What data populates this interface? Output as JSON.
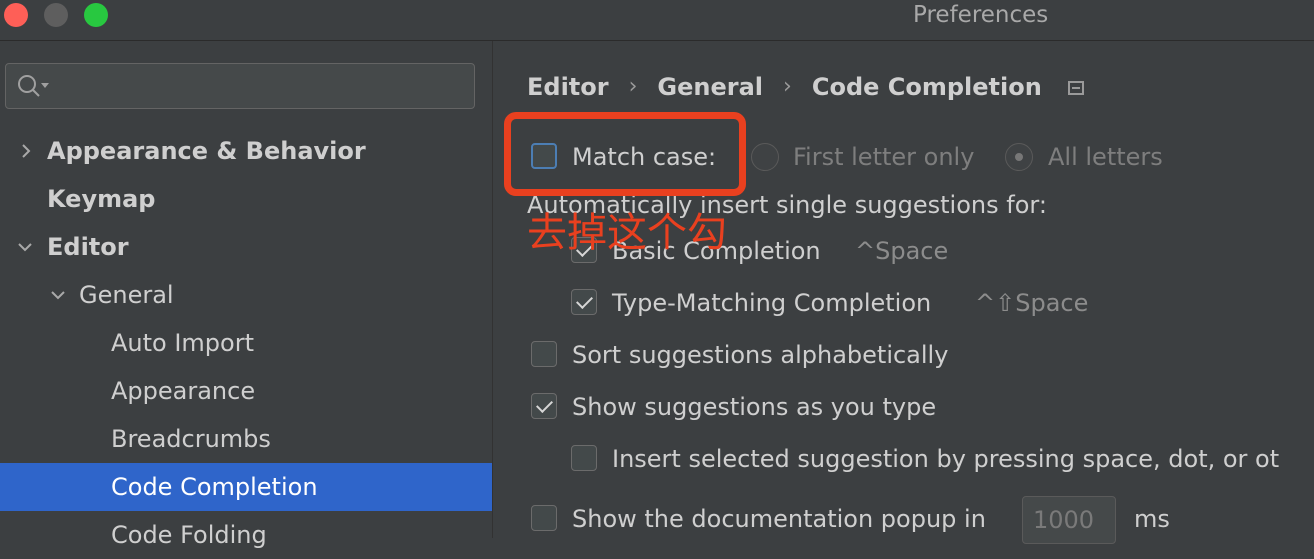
{
  "window": {
    "title": "Preferences"
  },
  "search": {
    "placeholder": "",
    "value": ""
  },
  "sidebar": {
    "items": [
      {
        "label": "Appearance & Behavior"
      },
      {
        "label": "Keymap"
      },
      {
        "label": "Editor"
      },
      {
        "label": "General"
      },
      {
        "label": "Auto Import"
      },
      {
        "label": "Appearance"
      },
      {
        "label": "Breadcrumbs"
      },
      {
        "label": "Code Completion",
        "selected": true
      },
      {
        "label": "Code Folding"
      }
    ]
  },
  "breadcrumb": {
    "items": [
      "Editor",
      "General",
      "Code Completion"
    ]
  },
  "settings": {
    "match_case": {
      "label": "Match case:",
      "checked": false
    },
    "radio_first_letter": {
      "label": "First letter only",
      "selected": false
    },
    "radio_all_letters": {
      "label": "All letters",
      "selected": true
    },
    "auto_insert_heading": "Automatically insert single suggestions for:",
    "basic_completion": {
      "label": "Basic Completion",
      "shortcut": "^Space",
      "checked": true
    },
    "type_matching": {
      "label": "Type-Matching Completion",
      "shortcut": "^⇧Space",
      "checked": true
    },
    "sort_alpha": {
      "label": "Sort suggestions alphabetically",
      "checked": false
    },
    "show_as_type": {
      "label": "Show suggestions as you type",
      "checked": true
    },
    "insert_selected": {
      "label": "Insert selected suggestion by pressing space, dot, or ot",
      "checked": false
    },
    "doc_popup": {
      "label": "Show the documentation popup in",
      "value": "1000",
      "unit": "ms",
      "checked": false
    }
  },
  "annotation": {
    "text": "去掉这个勾",
    "color": "#e9401f"
  },
  "colors": {
    "selection": "#2f65ca",
    "background": "#3c3f41",
    "annotation": "#e9401f"
  },
  "icons": [
    "search-icon",
    "chevron-right-icon",
    "chevron-down-icon",
    "breadcrumb-settings-icon"
  ]
}
